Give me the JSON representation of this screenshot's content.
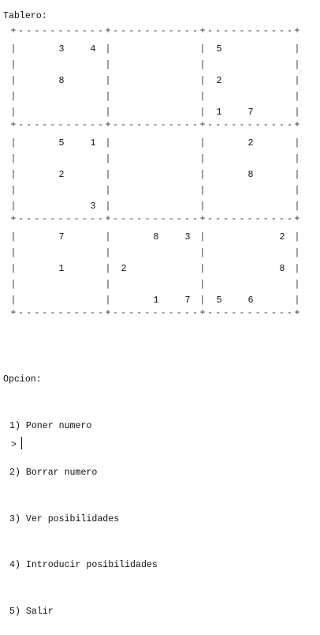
{
  "header": {
    "title": "Tablero:"
  },
  "board": {
    "dash_run": "-----------",
    "cells": [
      [
        3,
        4,
        null,
        null,
        null,
        5,
        null,
        null,
        null
      ],
      [
        8,
        null,
        null,
        null,
        null,
        2,
        null,
        null,
        null
      ],
      [
        null,
        null,
        null,
        null,
        null,
        1,
        null,
        7,
        null
      ],
      [
        5,
        1,
        null,
        null,
        null,
        null,
        null,
        2,
        null
      ],
      [
        2,
        null,
        null,
        null,
        null,
        null,
        null,
        8,
        null
      ],
      [
        null,
        3,
        null,
        null,
        null,
        null,
        null,
        null,
        null
      ],
      [
        7,
        null,
        null,
        8,
        3,
        null,
        null,
        null,
        2
      ],
      [
        1,
        null,
        2,
        null,
        null,
        null,
        null,
        null,
        8
      ],
      [
        null,
        null,
        null,
        1,
        7,
        null,
        5,
        6,
        null
      ]
    ]
  },
  "menu": {
    "heading": "Opcion:",
    "items": [
      "1) Poner numero",
      "2) Borrar numero",
      "3) Ver posibilidades",
      "4) Introducir posibilidades",
      "5) Salir"
    ]
  },
  "input": {
    "prompt": ">"
  }
}
